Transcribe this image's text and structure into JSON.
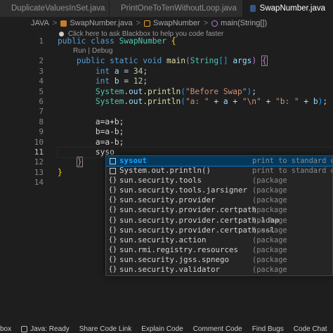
{
  "tabs": [
    {
      "label": "DuplicateValuesInSet.java",
      "icon": "java-file-icon"
    },
    {
      "label": "PrintOneToTenWithoutLoop.java",
      "icon": "java-file-icon"
    },
    {
      "label": "SwapNumber.java",
      "icon": "java-file-icon",
      "active": true
    }
  ],
  "breadcrumb": {
    "items": [
      "JAVA",
      "SwapNumber.java",
      "SwapNumber",
      "main(String[])"
    ],
    "separator": ">"
  },
  "hint": {
    "text": "Click here to ask Blackbox to help you code faster"
  },
  "codelens": {
    "run": "Run",
    "sep": "|",
    "debug": "Debug"
  },
  "line_numbers": [
    "1",
    "2",
    "3",
    "4",
    "5",
    "6",
    "7",
    "8",
    "9",
    "10",
    "11",
    "12",
    "13",
    "14"
  ],
  "current_line": "11",
  "code": {
    "l1": {
      "kw1": "public",
      "kw2": "class",
      "name": "SwapNumber",
      "brace": "{"
    },
    "l2": {
      "kw1": "public",
      "kw2": "static",
      "kw3": "void",
      "fn": "main",
      "p1": "(",
      "type": "String",
      "arr": "[]",
      "arg": "args",
      "p2": ")",
      "brace": "{"
    },
    "l3": {
      "kw": "int",
      "var": "a",
      "eq": " = ",
      "num": "34",
      "semi": ";"
    },
    "l4": {
      "kw": "int",
      "var": "b",
      "eq": " = ",
      "num": "12",
      "semi": ";"
    },
    "l5": {
      "obj": "System",
      "d1": ".",
      "out": "out",
      "d2": ".",
      "fn": "println",
      "p1": "(",
      "str": "\"Before Swap\"",
      "p2": ")",
      "semi": ";"
    },
    "l6": {
      "obj": "System",
      "d1": ".",
      "out": "out",
      "d2": ".",
      "fn": "println",
      "p1": "(",
      "s1": "\"a: \"",
      "op1": " + ",
      "va": "a",
      "op2": " + ",
      "s2": "\"\\n\"",
      "op3": " + ",
      "s3": "\"b: \"",
      "op4": " + ",
      "vb": "b",
      "p2": ")",
      "semi": ";"
    },
    "l8": "a=a+b;",
    "l9": "b=a-b;",
    "l10": "a=a-b;",
    "l11": "syso",
    "l12": "}",
    "l13": "}"
  },
  "suggestions": [
    {
      "hl": "sysout",
      "rest": "",
      "detail": "print to standard out",
      "kind": "snippet-icon",
      "selected": true
    },
    {
      "hl": "",
      "rest": "System.out.println()",
      "detail": "print to standard out",
      "kind": "snippet-icon"
    },
    {
      "hl": "",
      "rest": "sun.security.tools",
      "detail": "(package",
      "kind": "package-icon"
    },
    {
      "hl": "",
      "rest": "sun.security.tools.jarsigner",
      "detail": "(package",
      "kind": "package-icon"
    },
    {
      "hl": "",
      "rest": "sun.security.provider",
      "detail": "(package",
      "kind": "package-icon"
    },
    {
      "hl": "",
      "rest": "sun.security.provider.certpath",
      "detail": "(package",
      "kind": "package-icon"
    },
    {
      "hl": "",
      "rest": "sun.security.provider.certpath.ldap",
      "detail": "(package",
      "kind": "package-icon"
    },
    {
      "hl": "",
      "rest": "sun.security.provider.certpath.ssl",
      "detail": "(package",
      "kind": "package-icon"
    },
    {
      "hl": "",
      "rest": "sun.security.action",
      "detail": "(package",
      "kind": "package-icon"
    },
    {
      "hl": "",
      "rest": "sun.rmi.registry.resources",
      "detail": "(package",
      "kind": "package-icon"
    },
    {
      "hl": "",
      "rest": "sun.security.jgss.spnego",
      "detail": "(package",
      "kind": "package-icon"
    },
    {
      "hl": "",
      "rest": "sun.security.validator",
      "detail": "(package",
      "kind": "package-icon"
    }
  ],
  "package_icon_glyph": "{}",
  "statusbar": {
    "items": [
      "box",
      "Java: Ready",
      "Share Code Link",
      "Explain Code",
      "Comment Code",
      "Find Bugs",
      "Code Chat"
    ]
  },
  "colors": {
    "background": "#1e1e1e",
    "keyword": "#569cd6",
    "type": "#4ec9b0",
    "function": "#dcdcaa",
    "string": "#ce9178",
    "number": "#b5cea8",
    "variable": "#9cdcfe",
    "suggest_selected": "#04395e",
    "match_highlight": "#18a3ff"
  }
}
